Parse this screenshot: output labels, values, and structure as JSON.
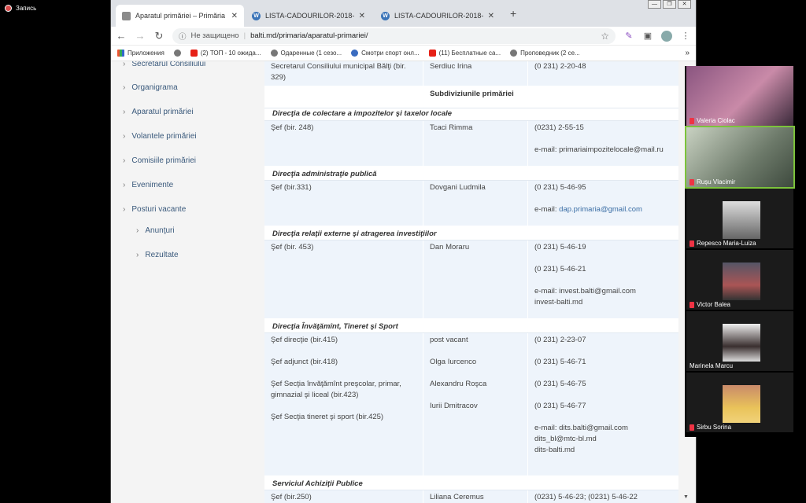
{
  "recording": {
    "label": "Запись"
  },
  "browser": {
    "tabs": [
      {
        "title": "Aparatul primăriei – Primăria mu",
        "icon": "crest-icon"
      },
      {
        "title": "LISTA-CADOURILOR-2018-2019",
        "icon": "wordpress-icon"
      },
      {
        "title": "LISTA-CADOURILOR-2018-2019",
        "icon": "wordpress-icon"
      }
    ],
    "new_tab": "+",
    "security": "Не защищено",
    "url": "balti.md/primaria/aparatul-primariei/",
    "bookmarks": [
      {
        "label": "Приложения",
        "icon": "apps-grid-icon"
      },
      {
        "label": "",
        "icon": "globe-icon"
      },
      {
        "label": "(2) ТОП - 10 ожида...",
        "icon": "youtube-icon"
      },
      {
        "label": "Одаренные (1 сезо...",
        "icon": "avatar-icon"
      },
      {
        "label": "Смотри спорт онл...",
        "icon": "sport-icon"
      },
      {
        "label": "(11) Бесплатные са...",
        "icon": "youtube-icon"
      },
      {
        "label": "Проповедник (2 се...",
        "icon": "avatar-icon"
      }
    ],
    "more": "»"
  },
  "sidebar": {
    "items": [
      {
        "label": "Secretarul Consiliului"
      },
      {
        "label": "Organigrama"
      },
      {
        "label": "Aparatul primăriei"
      },
      {
        "label": "Volantele primăriei"
      },
      {
        "label": "Comisiile primăriei"
      },
      {
        "label": "Evenimente"
      },
      {
        "label": "Posturi vacante"
      },
      {
        "label": "Anunţuri"
      },
      {
        "label": "Rezultate"
      }
    ]
  },
  "table": {
    "top_row": {
      "role": "Secretarul Consiliului municipal Bălţi (bir. 329)",
      "name": "Serdiuc Irina",
      "phone": "(0 231) 2-20-48"
    },
    "subheader": "Subdiviziunile primăriei",
    "sections": [
      {
        "title": "Direcţia de colectare a impozitelor şi taxelor locale",
        "role": "Şef (bir. 248)",
        "name": "Tcaci Rimma",
        "phones": [
          "(0231) 2-55-15"
        ],
        "email": "e-mail: primariaimpozitelocale@mail.ru"
      },
      {
        "title": "Direcţia administraţie publică",
        "role": "Şef (bir.331)",
        "name": "Dovgani Ludmila",
        "phones": [
          "(0 231) 5-46-95"
        ],
        "email_prefix": "e-mail: ",
        "email_link": "dap.primaria@gmail.com"
      },
      {
        "title": "Direcţia relaţii externe şi atragerea investiţiilor",
        "role": "Şef (bir. 453)",
        "name": "Dan Moraru",
        "phones": [
          "(0 231) 5-46-19",
          "(0 231) 5-46-21"
        ],
        "email": "e-mail: invest.balti@gmail.com",
        "site": "invest-balti.md"
      },
      {
        "title": "Direcţia Învăţămînt, Tineret şi Sport",
        "roles": [
          "Şef direcţie (bir.415)",
          "Şef adjunct (bir.418)",
          "Şef Secţia învăţămînt preşcolar, primar,",
          "gimnazial şi liceal (bir.423)",
          "Şef Secţia tineret şi sport (bir.425)"
        ],
        "names": [
          "post vacant",
          "Olga Iurcenco",
          "Alexandru Roşca",
          "Iurii Dmitracov"
        ],
        "phones": [
          "(0 231) 2-23-07",
          "(0 231) 5-46-71",
          "(0 231) 5-46-75",
          "(0 231) 5-46-77"
        ],
        "email": "e-mail: dits.balti@gmail.com",
        "email2": "dits_bl@mtc-bl.md",
        "site": "dits-balti.md"
      },
      {
        "title": "Serviciul Achiziţii Publice",
        "role": "Şef (bir.250)",
        "name": "Liliana Ceremus",
        "phones": [
          "(0231) 5-46-23; (0231) 5-46-22"
        ]
      }
    ]
  },
  "participants": [
    {
      "name": "Valeria Ciolac",
      "muted": true,
      "video": true,
      "tone": "#7b4a6a"
    },
    {
      "name": "Rușu Vlacimir",
      "muted": true,
      "video": true,
      "active": true,
      "tone": "#6d7a6a"
    },
    {
      "name": "Repesco Maria-Luiza",
      "muted": true,
      "video": false,
      "tone": "#999999"
    },
    {
      "name": "Victor Balea",
      "muted": true,
      "video": false,
      "tone": "#7a5a4a"
    },
    {
      "name": "Marinela Marcu",
      "muted": false,
      "video": false,
      "tone": "#8a6a6a"
    },
    {
      "name": "Sirbu Sorina",
      "muted": true,
      "video": false,
      "tone": "#d6b06a"
    }
  ]
}
